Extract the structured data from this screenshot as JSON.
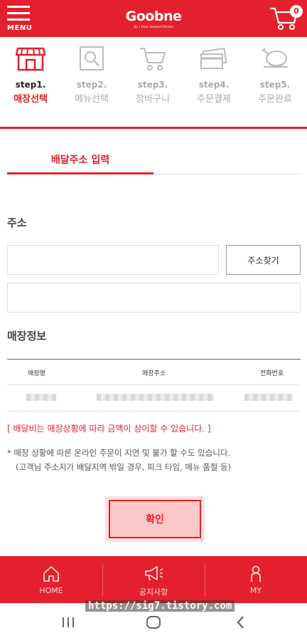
{
  "header": {
    "menu_label": "MENU",
    "logo_main": "Goobne",
    "logo_sub": "No.1 Oven Roasted Chicken",
    "cart_count": "0"
  },
  "steps": [
    {
      "num": "step1.",
      "name": "매장선택",
      "icon": "store-icon",
      "active": true
    },
    {
      "num": "step2.",
      "name": "메뉴선택",
      "icon": "menu-search-icon",
      "active": false
    },
    {
      "num": "step3.",
      "name": "장바구니",
      "icon": "cart-icon",
      "active": false
    },
    {
      "num": "step4.",
      "name": "주문결제",
      "icon": "card-icon",
      "active": false
    },
    {
      "num": "step5.",
      "name": "주문완료",
      "icon": "chicken-icon",
      "active": false
    }
  ],
  "tab": {
    "label": "배달주소 입력"
  },
  "address": {
    "title": "주소",
    "main_value": "",
    "main_placeholder": "",
    "detail_value": "",
    "detail_placeholder": "",
    "find_label": "주소찾기"
  },
  "store": {
    "title": "매장정보",
    "columns": [
      "매장명",
      "매장주소",
      "전화번호"
    ]
  },
  "notices": {
    "red": "[ 배달비는 매장상황에 따라 금액이 상이할 수 있습니다. ]",
    "gray_line1": "* 매장 상황에 따른 온라인 주문이 지연 및 불가 할 수도 있습니다.",
    "gray_line2": "(고객님 주소지가 배달지역 밖일 경우, 피크 타임, 메뉴 품절 등)"
  },
  "confirm_label": "확인",
  "bottom_nav": [
    {
      "label": "HOME",
      "icon": "home-icon"
    },
    {
      "label": "공지사항",
      "icon": "megaphone-icon"
    },
    {
      "label": "MY",
      "icon": "person-icon"
    }
  ],
  "watermark": "https://sig7.tistory.com",
  "colors": {
    "brand": "#e4202e"
  }
}
